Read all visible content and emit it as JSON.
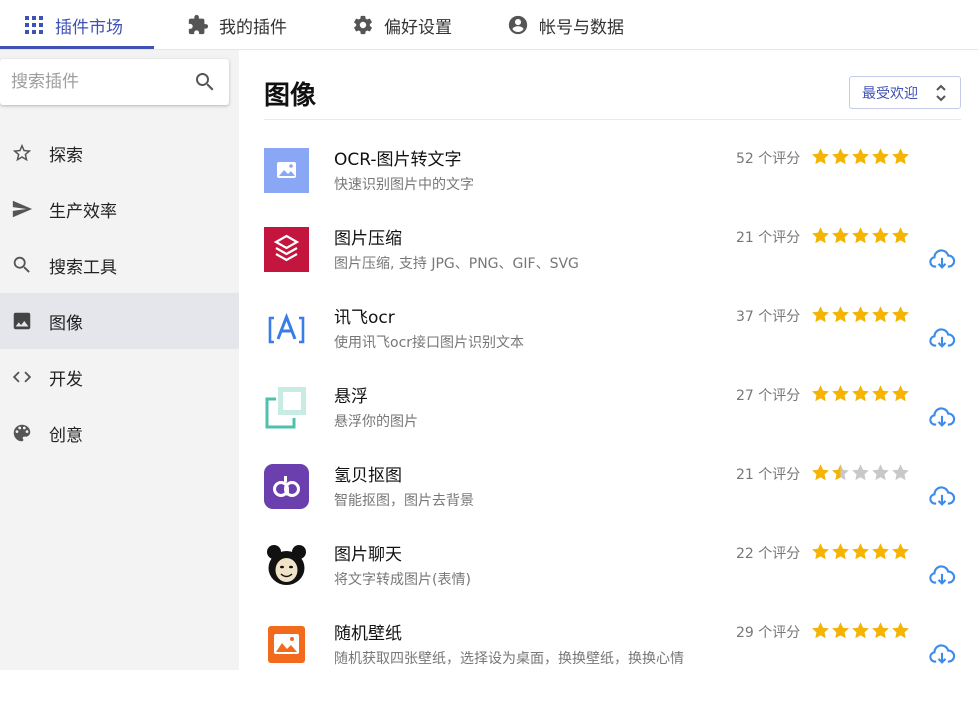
{
  "tabs": [
    {
      "label": "插件市场",
      "icon": "grid-icon"
    },
    {
      "label": "我的插件",
      "icon": "puzzle-icon"
    },
    {
      "label": "偏好设置",
      "icon": "gear-icon"
    },
    {
      "label": "帐号与数据",
      "icon": "account-circle-icon"
    }
  ],
  "search": {
    "placeholder": "搜索插件",
    "value": ""
  },
  "sidebar": {
    "items": [
      {
        "label": "探索",
        "icon": "star-outline-icon"
      },
      {
        "label": "生产效率",
        "icon": "send-icon"
      },
      {
        "label": "搜索工具",
        "icon": "search-icon"
      },
      {
        "label": "图像",
        "icon": "image-icon",
        "active": true
      },
      {
        "label": "开发",
        "icon": "code-icon"
      },
      {
        "label": "创意",
        "icon": "palette-icon"
      }
    ]
  },
  "main": {
    "title": "图像",
    "sort": {
      "selected": "最受欢迎"
    },
    "plugins": [
      {
        "name": "OCR-图片转文字",
        "desc": "快速识别图片中的文字",
        "count": "52 个评分",
        "rating": 5,
        "installed": true,
        "icon": "ocr-image-icon"
      },
      {
        "name": "图片压缩",
        "desc": "图片压缩, 支持 JPG、PNG、GIF、SVG",
        "count": "21 个评分",
        "rating": 5,
        "installed": false,
        "icon": "layers-compress-icon"
      },
      {
        "name": "讯飞ocr",
        "desc": "使用讯飞ocr接口图片识别文本",
        "count": "37 个评分",
        "rating": 5,
        "installed": false,
        "icon": "scan-letter-a-icon"
      },
      {
        "name": "悬浮",
        "desc": "悬浮你的图片",
        "count": "27 个评分",
        "rating": 5,
        "installed": false,
        "icon": "float-window-icon"
      },
      {
        "name": "氢贝抠图",
        "desc": "智能抠图，图片去背景",
        "count": "21 个评分",
        "rating": 1.5,
        "installed": false,
        "icon": "qingbei-logo-icon"
      },
      {
        "name": "图片聊天",
        "desc": "将文字转成图片(表情)",
        "count": "22 个评分",
        "rating": 5,
        "installed": false,
        "icon": "panda-meme-icon"
      },
      {
        "name": "随机壁纸",
        "desc": "随机获取四张壁纸，选择设为桌面，换换壁纸，换换心情",
        "count": "29 个评分",
        "rating": 5,
        "installed": false,
        "icon": "wallpaper-icon"
      }
    ]
  },
  "colors": {
    "accent": "#3f51b5",
    "star_filled": "#f6b400",
    "star_empty": "#c8c8c8",
    "download": "#3b8beb",
    "sidebar_bg": "#f3f3f3",
    "sidebar_active": "#e5e5ec"
  }
}
